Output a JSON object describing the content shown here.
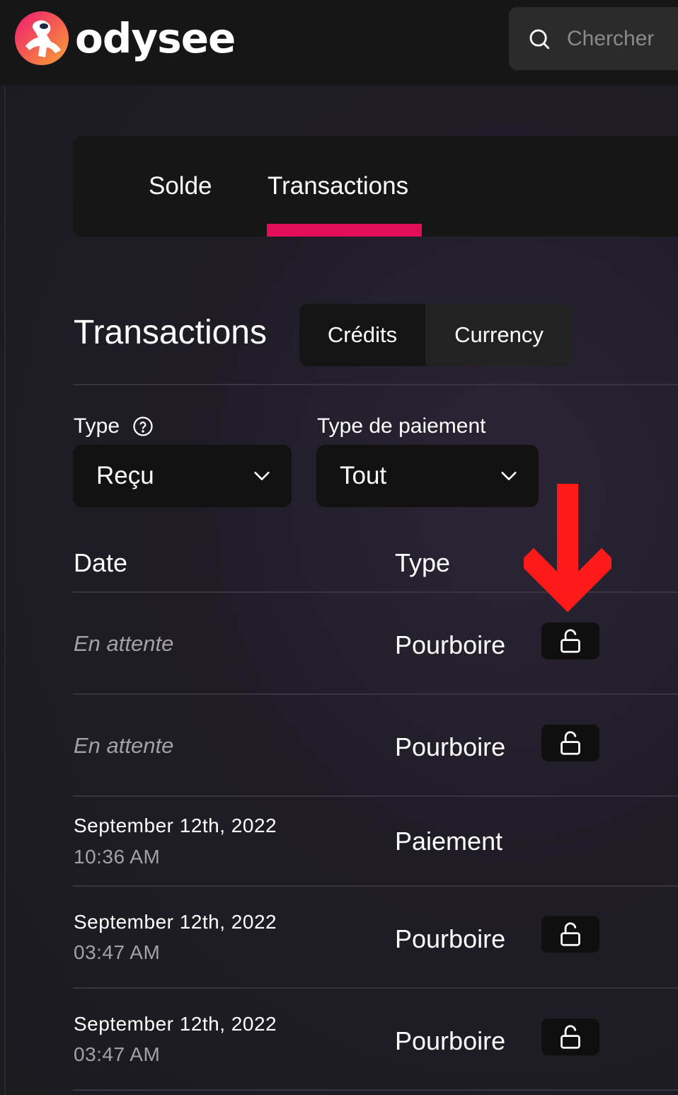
{
  "app": {
    "logo_text": "odysee"
  },
  "search": {
    "placeholder": "Chercher"
  },
  "wallet_tabs": [
    {
      "label": "Solde"
    },
    {
      "label": "Transactions",
      "active": true
    }
  ],
  "transactions": {
    "title": "Transactions",
    "currency_toggle": [
      {
        "label": "Crédits",
        "active": true
      },
      {
        "label": "Currency"
      }
    ],
    "filters": {
      "type_label": "Type",
      "type_value": "Reçu",
      "payment_label": "Type de paiement",
      "payment_value": "Tout"
    },
    "columns": {
      "date": "Date",
      "type": "Type"
    },
    "rows": [
      {
        "date": "En attente",
        "type": "Pourboire",
        "lock": true
      },
      {
        "date": "En attente",
        "type": "Pourboire",
        "lock": true
      },
      {
        "date": "September 12th, 2022",
        "time": "10:36 AM",
        "type": "Paiement",
        "lock": false
      },
      {
        "date": "September 12th, 2022",
        "time": "03:47 AM",
        "type": "Pourboire",
        "lock": true
      },
      {
        "date": "September 12th, 2022",
        "time": "03:47 AM",
        "type": "Pourboire",
        "lock": true
      }
    ]
  },
  "icons": [
    "search-icon",
    "help-circle-icon",
    "chevron-down-icon",
    "unlock-icon",
    "red-arrow-down-icon"
  ],
  "colors": {
    "accent": "#e30e59",
    "annotation_arrow": "#ff1a1a"
  }
}
